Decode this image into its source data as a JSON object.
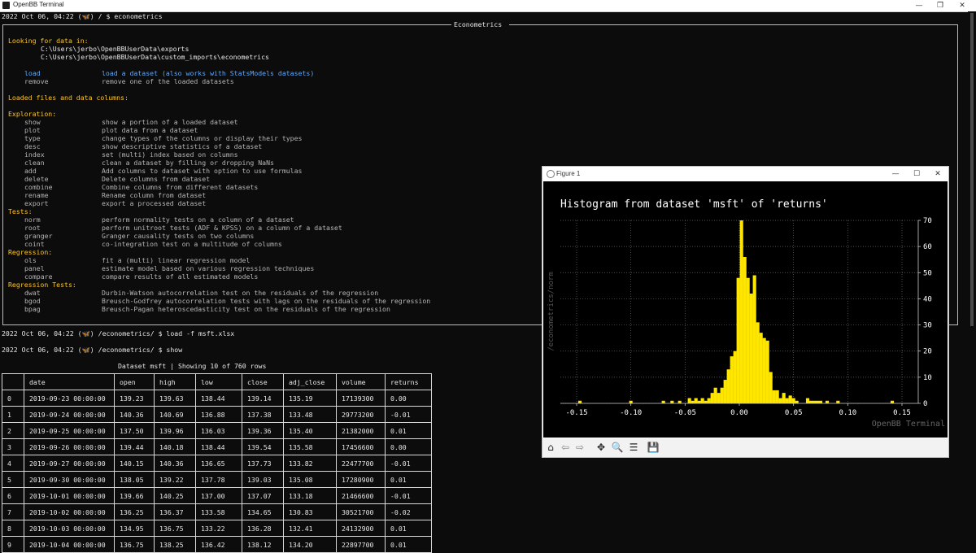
{
  "window": {
    "title": "OpenBB Terminal",
    "minimize": "—",
    "maximize": "❐",
    "close": "✕"
  },
  "prompt1": "2022 Oct 06, 04:22 (🦋) / $ econometrics",
  "menu": {
    "title": "Econometrics",
    "looking_for": "Looking for data in:",
    "paths": [
      "C:\\Users\\jerbo\\OpenBBUserData\\exports",
      "C:\\Users\\jerbo\\OpenBBUserData\\custom_imports\\econometrics"
    ],
    "actions": [
      {
        "cmd": "load",
        "desc": "load a dataset (also works with StatsModels datasets)"
      },
      {
        "cmd": "remove",
        "desc": "remove one of the loaded datasets"
      }
    ],
    "loaded_label": "Loaded files and data columns:",
    "sections": [
      {
        "title": "Exploration:",
        "items": [
          {
            "cmd": "show",
            "desc": "show a portion of a loaded dataset"
          },
          {
            "cmd": "plot",
            "desc": "plot data from a dataset"
          },
          {
            "cmd": "type",
            "desc": "change types of the columns or display their types"
          },
          {
            "cmd": "desc",
            "desc": "show descriptive statistics of a dataset"
          },
          {
            "cmd": "index",
            "desc": "set (multi) index based on columns"
          },
          {
            "cmd": "clean",
            "desc": "clean a dataset by filling or dropping NaNs"
          },
          {
            "cmd": "add",
            "desc": "Add columns to dataset with option to use formulas"
          },
          {
            "cmd": "delete",
            "desc": "Delete columns from dataset"
          },
          {
            "cmd": "combine",
            "desc": "Combine columns from different datasets"
          },
          {
            "cmd": "rename",
            "desc": "Rename column from dataset"
          },
          {
            "cmd": "export",
            "desc": "export a processed dataset"
          }
        ]
      },
      {
        "title": "Tests:",
        "items": [
          {
            "cmd": "norm",
            "desc": "perform normality tests on a column of a dataset"
          },
          {
            "cmd": "root",
            "desc": "perform unitroot tests (ADF & KPSS) on a column of a dataset"
          },
          {
            "cmd": "granger",
            "desc": "Granger causality tests on two columns"
          },
          {
            "cmd": "coint",
            "desc": "co-integration test on a multitude of columns"
          }
        ]
      },
      {
        "title": "Regression:",
        "items": [
          {
            "cmd": "ols",
            "desc": "fit a (multi) linear regression model"
          },
          {
            "cmd": "panel",
            "desc": "estimate model based on various regression techniques"
          },
          {
            "cmd": "compare",
            "desc": "compare results of all estimated models"
          }
        ]
      },
      {
        "title": "Regression Tests:",
        "items": [
          {
            "cmd": "dwat",
            "desc": "Durbin-Watson autocorrelation test on the residuals of the regression"
          },
          {
            "cmd": "bgod",
            "desc": "Breusch-Godfrey autocorrelation tests with lags on the residuals of the regression"
          },
          {
            "cmd": "bpag",
            "desc": "Breusch-Pagan heteroscedasticity test on the residuals of the regression"
          }
        ]
      }
    ]
  },
  "prompt2": "2022 Oct 06, 04:22 (🦋) /econometrics/ $ load -f msft.xlsx",
  "prompt3": "2022 Oct 06, 04:22 (🦋) /econometrics/ $ show",
  "table": {
    "caption": "Dataset msft | Showing 10 of 760 rows",
    "headers": [
      "",
      "date",
      "open",
      "high",
      "low",
      "close",
      "adj_close",
      "volume",
      "returns"
    ],
    "rows": [
      [
        "0",
        "2019-09-23 00:00:00",
        "139.23",
        "139.63",
        "138.44",
        "139.14",
        "135.19",
        "17139300",
        "0.00"
      ],
      [
        "1",
        "2019-09-24 00:00:00",
        "140.36",
        "140.69",
        "136.88",
        "137.38",
        "133.48",
        "29773200",
        "-0.01"
      ],
      [
        "2",
        "2019-09-25 00:00:00",
        "137.50",
        "139.96",
        "136.03",
        "139.36",
        "135.40",
        "21382000",
        "0.01"
      ],
      [
        "3",
        "2019-09-26 00:00:00",
        "139.44",
        "140.18",
        "138.44",
        "139.54",
        "135.58",
        "17456600",
        "0.00"
      ],
      [
        "4",
        "2019-09-27 00:00:00",
        "140.15",
        "140.36",
        "136.65",
        "137.73",
        "133.82",
        "22477700",
        "-0.01"
      ],
      [
        "5",
        "2019-09-30 00:00:00",
        "138.05",
        "139.22",
        "137.78",
        "139.03",
        "135.08",
        "17280900",
        "0.01"
      ],
      [
        "6",
        "2019-10-01 00:00:00",
        "139.66",
        "140.25",
        "137.00",
        "137.07",
        "133.18",
        "21466600",
        "-0.01"
      ],
      [
        "7",
        "2019-10-02 00:00:00",
        "136.25",
        "136.37",
        "133.58",
        "134.65",
        "130.83",
        "30521700",
        "-0.02"
      ],
      [
        "8",
        "2019-10-03 00:00:00",
        "134.95",
        "136.75",
        "133.22",
        "136.28",
        "132.41",
        "24132900",
        "0.01"
      ],
      [
        "9",
        "2019-10-04 00:00:00",
        "136.75",
        "138.25",
        "136.42",
        "138.12",
        "134.20",
        "22897700",
        "0.01"
      ]
    ]
  },
  "figure": {
    "title": "Figure 1",
    "toolbar": [
      "home-icon",
      "back-icon",
      "forward-icon",
      "pan-icon",
      "zoom-icon",
      "configure-icon",
      "save-icon"
    ]
  },
  "chart_data": {
    "type": "bar",
    "title": "Histogram from dataset 'msft' of 'returns'",
    "ylabel": "/econometrics/norm",
    "xlabel": "",
    "watermark": "OpenBB Terminal",
    "bar_color": "#ffe600",
    "bin_width": 0.0031,
    "xlim": [
      -0.165,
      0.165
    ],
    "ylim": [
      0,
      70
    ],
    "x_ticks": [
      "-0.15",
      "-0.10",
      "-0.05",
      "0.00",
      "0.05",
      "0.10",
      "0.15"
    ],
    "y_ticks": [
      "0",
      "10",
      "20",
      "30",
      "40",
      "50",
      "60",
      "70"
    ],
    "grid": true,
    "bins": [
      {
        "x": -0.147,
        "y": 1
      },
      {
        "x": -0.1,
        "y": 1
      },
      {
        "x": -0.07,
        "y": 1
      },
      {
        "x": -0.062,
        "y": 1
      },
      {
        "x": -0.055,
        "y": 1
      },
      {
        "x": -0.046,
        "y": 2
      },
      {
        "x": -0.043,
        "y": 1
      },
      {
        "x": -0.04,
        "y": 2
      },
      {
        "x": -0.037,
        "y": 1
      },
      {
        "x": -0.034,
        "y": 2
      },
      {
        "x": -0.031,
        "y": 1
      },
      {
        "x": -0.028,
        "y": 2
      },
      {
        "x": -0.025,
        "y": 4
      },
      {
        "x": -0.022,
        "y": 6
      },
      {
        "x": -0.019,
        "y": 4
      },
      {
        "x": -0.016,
        "y": 6
      },
      {
        "x": -0.013,
        "y": 9
      },
      {
        "x": -0.01,
        "y": 13
      },
      {
        "x": -0.007,
        "y": 18
      },
      {
        "x": -0.004,
        "y": 20
      },
      {
        "x": -0.001,
        "y": 48
      },
      {
        "x": 0.002,
        "y": 70
      },
      {
        "x": 0.005,
        "y": 56
      },
      {
        "x": 0.008,
        "y": 48
      },
      {
        "x": 0.011,
        "y": 42
      },
      {
        "x": 0.014,
        "y": 49
      },
      {
        "x": 0.017,
        "y": 31
      },
      {
        "x": 0.02,
        "y": 27
      },
      {
        "x": 0.023,
        "y": 25
      },
      {
        "x": 0.026,
        "y": 24
      },
      {
        "x": 0.029,
        "y": 12
      },
      {
        "x": 0.032,
        "y": 5
      },
      {
        "x": 0.035,
        "y": 5
      },
      {
        "x": 0.038,
        "y": 2
      },
      {
        "x": 0.041,
        "y": 4
      },
      {
        "x": 0.044,
        "y": 2
      },
      {
        "x": 0.047,
        "y": 3
      },
      {
        "x": 0.05,
        "y": 2
      },
      {
        "x": 0.053,
        "y": 1
      },
      {
        "x": 0.063,
        "y": 2
      },
      {
        "x": 0.066,
        "y": 1
      },
      {
        "x": 0.069,
        "y": 1
      },
      {
        "x": 0.072,
        "y": 1
      },
      {
        "x": 0.075,
        "y": 1
      },
      {
        "x": 0.081,
        "y": 1
      },
      {
        "x": 0.091,
        "y": 1
      },
      {
        "x": 0.141,
        "y": 1
      }
    ]
  }
}
